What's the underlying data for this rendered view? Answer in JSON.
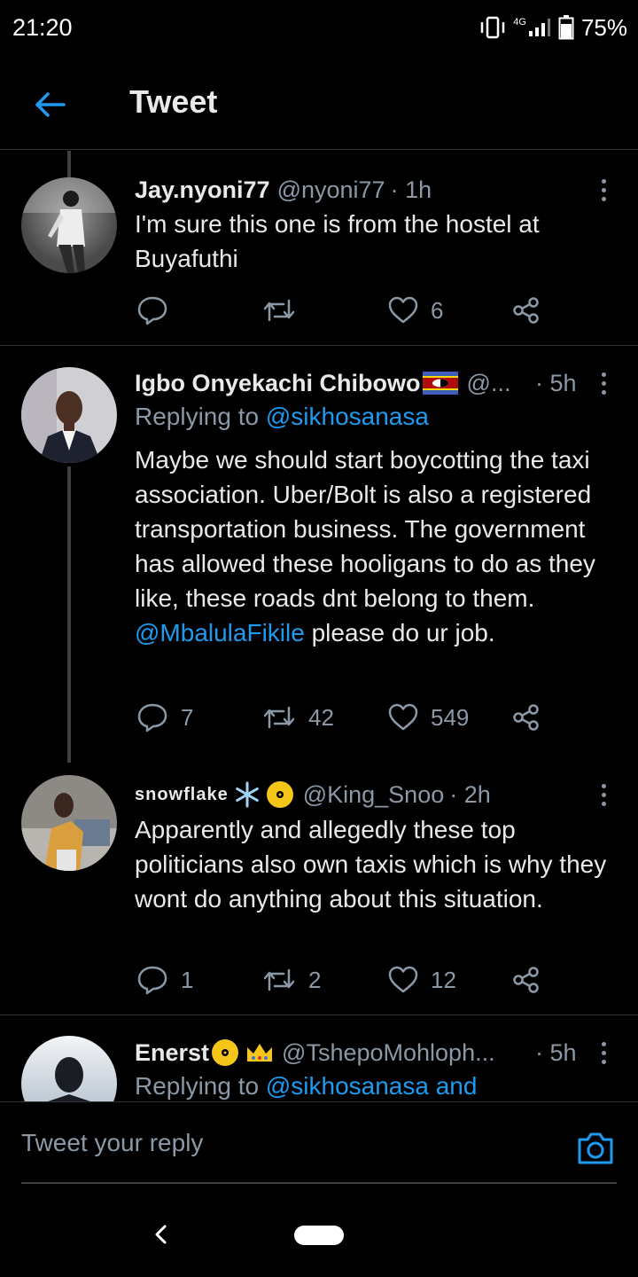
{
  "status_bar": {
    "time": "21:20",
    "network": "4G",
    "battery_pct": "75%",
    "battery_level": 0.75
  },
  "header": {
    "title": "Tweet"
  },
  "tweets": [
    {
      "name": "Jay.nyoni77",
      "handle": "@nyoni77",
      "time": "· 1h",
      "body": "I'm sure this one is from the hostel at Buyafuthi",
      "reply_count": "",
      "retweet_count": "",
      "like_count": "6"
    },
    {
      "name": "Igbo Onyekachi Chibowo",
      "name_emoji": "flag-eswatini",
      "handle": "@...",
      "time": "· 5h",
      "replying_prefix": "Replying to ",
      "replying_to": "@sikhosanasa",
      "body_part1": "Maybe we should start boycotting the taxi association. Uber/Bolt is also a registered transportation business. The government has allowed these hooligans to do as they like, these roads dnt belong to them. ",
      "body_mention": "@MbalulaFikile",
      "body_part2": " please do ur job.",
      "reply_count": "7",
      "retweet_count": "42",
      "like_count": "549"
    },
    {
      "name": "snowflake",
      "name_emoji": [
        "snowflake",
        "dvd"
      ],
      "handle": "@King_Snoo",
      "time": "· 2h",
      "body": "Apparently and allegedly these top politicians also own taxis which is why they wont do anything about this situation.",
      "reply_count": "1",
      "retweet_count": "2",
      "like_count": "12"
    },
    {
      "name": "Enerst",
      "name_emoji": [
        "dvd",
        "crown"
      ],
      "handle": "@TshepoMohloph...",
      "time": "· 5h",
      "replying_prefix": "Replying to ",
      "replying_to": "@sikhosanasa and"
    }
  ],
  "reply_bar": {
    "placeholder": "Tweet your reply"
  },
  "colors": {
    "background": "#000000",
    "text": "#e7e9ea",
    "muted": "#8b98a5",
    "accent": "#1d9bf0",
    "divider": "#2f3336"
  },
  "icons": [
    "back-arrow-icon",
    "reply-icon",
    "retweet-icon",
    "like-icon",
    "share-icon",
    "more-icon",
    "camera-icon",
    "vibrate-icon",
    "signal-icon",
    "battery-icon"
  ]
}
